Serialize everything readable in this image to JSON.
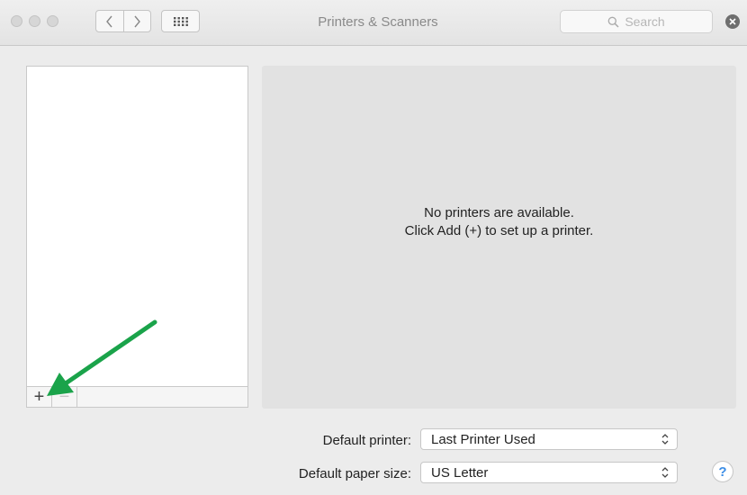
{
  "window": {
    "title": "Printers & Scanners"
  },
  "toolbar": {
    "search_placeholder": "Search"
  },
  "list_controls": {
    "add_label": "+",
    "remove_label": "−"
  },
  "detail": {
    "line1": "No printers are available.",
    "line2": "Click Add (+) to set up a printer."
  },
  "form": {
    "default_printer_label": "Default printer:",
    "default_printer_value": "Last Printer Used",
    "default_paper_label": "Default paper size:",
    "default_paper_value": "US Letter"
  },
  "help": {
    "label": "?"
  },
  "icons": {
    "back": "chevron-left-icon",
    "forward": "chevron-right-icon",
    "grid": "grid-icon",
    "search": "search-icon",
    "clear": "clear-icon",
    "popup": "updown-chevron-icon",
    "annotation": "green-arrow-icon"
  },
  "colors": {
    "annotation_arrow": "#1aa34a",
    "help_accent": "#3b8de6",
    "detail_background": "#e2e2e2"
  }
}
